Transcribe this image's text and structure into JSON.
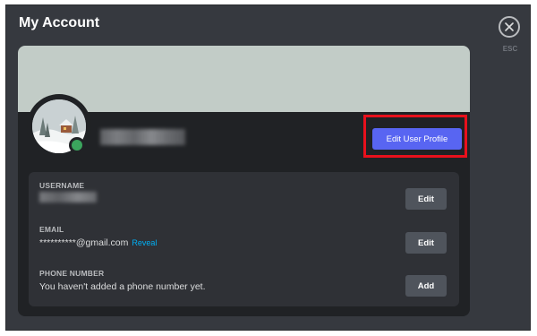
{
  "window": {
    "title": "My Account",
    "esc_label": "ESC"
  },
  "icons": {
    "close": "close-icon",
    "avatar": "avatar-winter-cabin",
    "status": "online-status"
  },
  "colors": {
    "accent": "#5865f2",
    "status_online": "#3ba55d",
    "link": "#00aff4",
    "highlight": "#e8101c"
  },
  "profile": {
    "edit_button": "Edit User Profile"
  },
  "fields": [
    {
      "label": "USERNAME",
      "value": "",
      "button": "Edit"
    },
    {
      "label": "EMAIL",
      "value": "**********@gmail.com",
      "link": "Reveal",
      "button": "Edit"
    },
    {
      "label": "PHONE NUMBER",
      "value": "You haven't added a phone number yet.",
      "button": "Add"
    }
  ]
}
